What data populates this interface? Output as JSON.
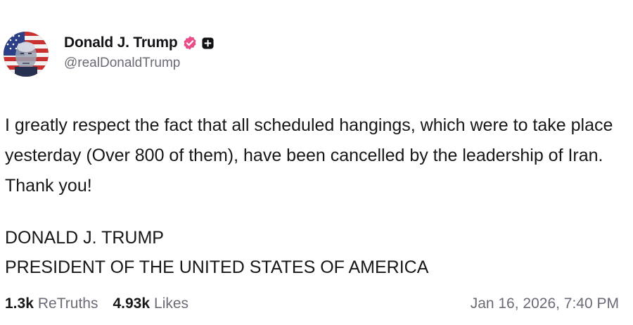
{
  "post": {
    "author": {
      "display_name": "Donald J. Trump",
      "handle": "@realDonaldTrump",
      "avatar_icon": "flag-portrait-avatar",
      "verified_icon": "verified-badge-icon",
      "verified_color": "#e94e8a",
      "subscribe_icon": "plus-square-icon"
    },
    "body": "I greatly respect the fact that all scheduled hangings, which were to take place yesterday (Over 800 of them), have been cancelled by the leadership of Iran. Thank you!",
    "signature": {
      "line1": "DONALD J. TRUMP",
      "line2": "PRESIDENT OF THE UNITED STATES OF AMERICA"
    },
    "stats": {
      "retruths_count": "1.3k",
      "retruths_label": "ReTruths",
      "likes_count": "4.93k",
      "likes_label": "Likes"
    },
    "timestamp": "Jan 16, 2026, 7:40 PM"
  }
}
